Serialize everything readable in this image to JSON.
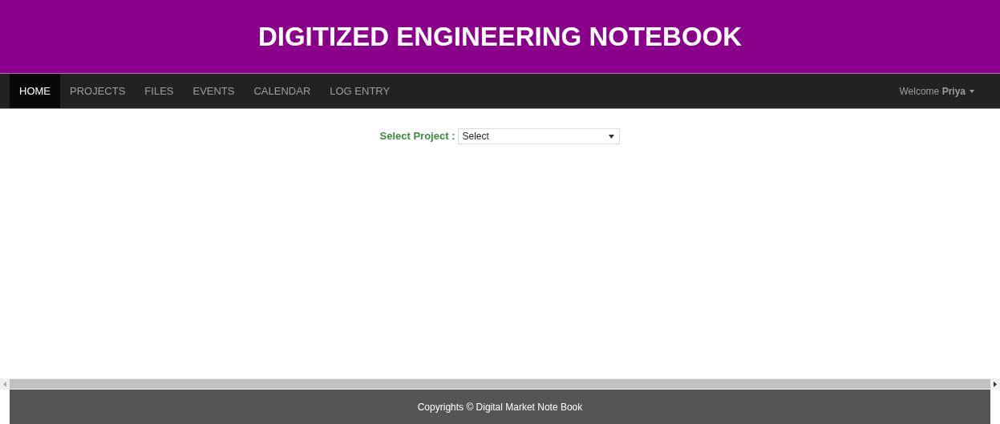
{
  "header": {
    "title": "DIGITIZED ENGINEERING NOTEBOOK"
  },
  "nav": {
    "items": [
      {
        "label": "HOME",
        "selected": true
      },
      {
        "label": "PROJECTS",
        "selected": false
      },
      {
        "label": "FILES",
        "selected": false
      },
      {
        "label": "EVENTS",
        "selected": false
      },
      {
        "label": "CALENDAR",
        "selected": false
      },
      {
        "label": "LOG ENTRY",
        "selected": false
      }
    ],
    "user_menu": "Welcome **Priya**"
  },
  "project_select": {
    "label": "Select Project :",
    "value": "Select"
  },
  "footer": {
    "text": "Copyrights © Digital Market Note Book"
  }
}
